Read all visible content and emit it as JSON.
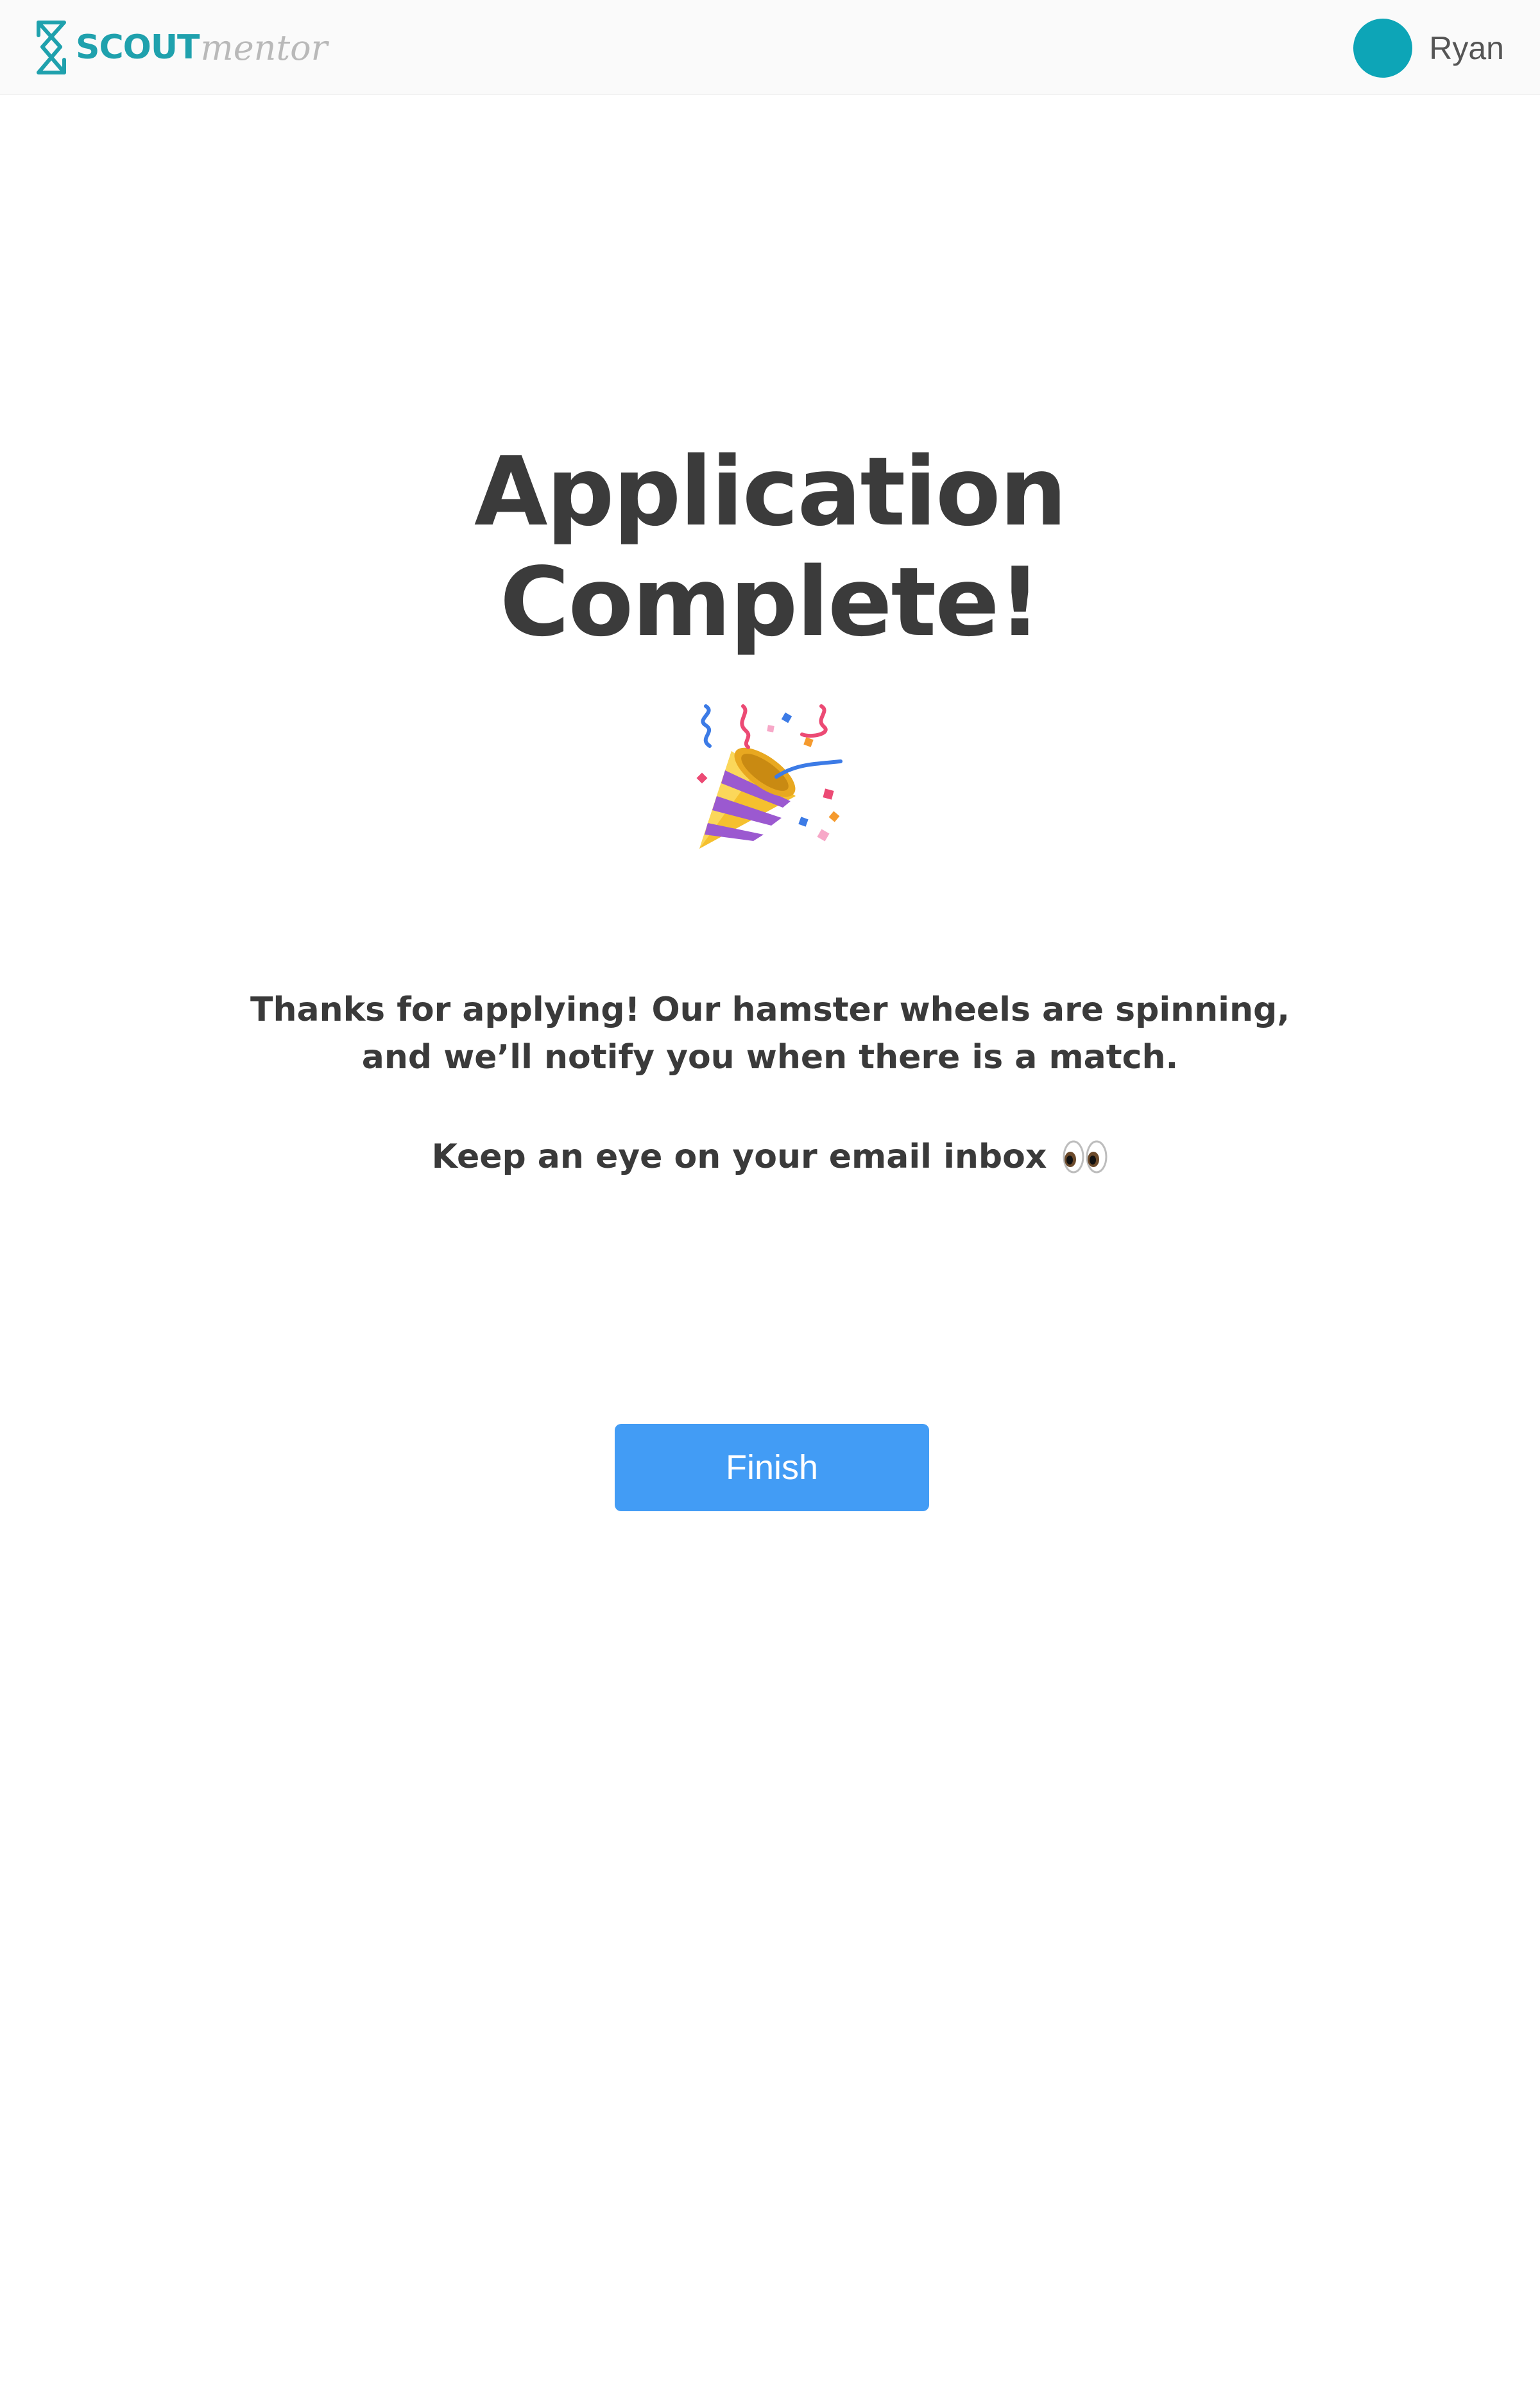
{
  "header": {
    "brand_primary": "SCOUT",
    "brand_secondary": "mentor",
    "user_name": "Ryan",
    "avatar_color": "#0da5b7",
    "brand_color": "#1fa1ad"
  },
  "main": {
    "title_line1": "Application",
    "title_line2": "Complete!",
    "celebration_icon": "party-popper-icon",
    "message_line1": "Thanks for applying! Our hamster wheels are spinning,",
    "message_line2": "and we’ll notify you when there is a match.",
    "inbox_text": "Keep an eye on your email inbox",
    "inbox_icon": "eyes-icon",
    "finish_label": "Finish",
    "button_color": "#429cf5"
  }
}
